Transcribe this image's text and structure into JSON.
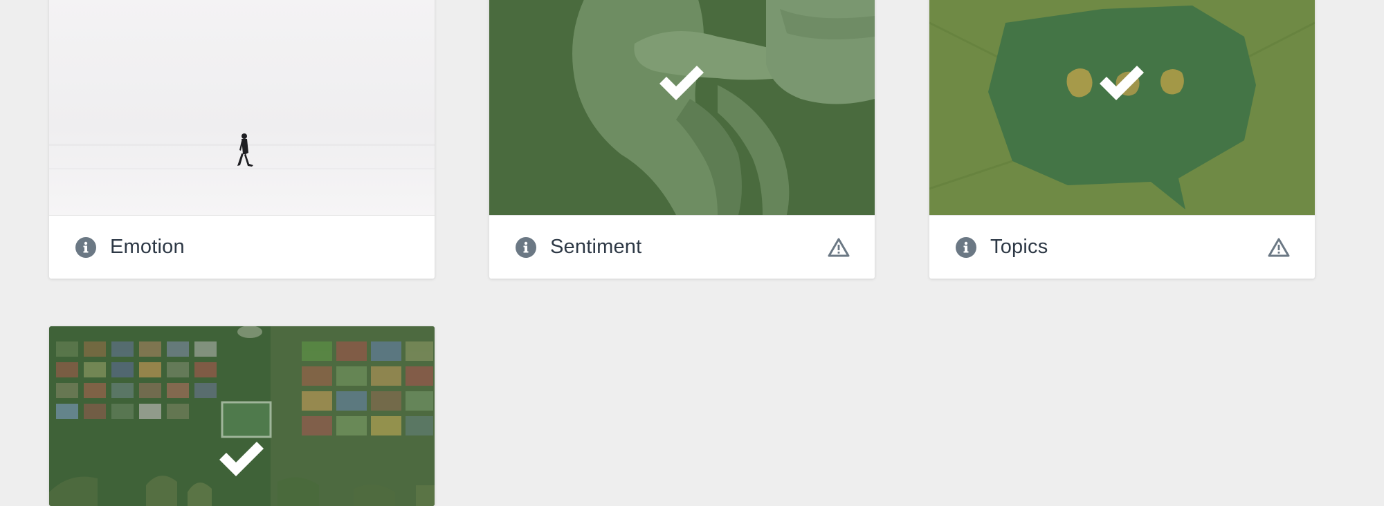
{
  "cards": [
    {
      "title": "Emotion",
      "selected": false,
      "warning": false,
      "icon": "info-icon",
      "image": "person-walking-snow"
    },
    {
      "title": "Sentiment",
      "selected": true,
      "warning": true,
      "icon": "info-icon",
      "image": "holding-hands"
    },
    {
      "title": "Topics",
      "selected": true,
      "warning": true,
      "icon": "info-icon",
      "image": "speech-bubble"
    },
    {
      "title": "",
      "selected": true,
      "warning": false,
      "icon": "info-icon",
      "image": "flags-cafe"
    }
  ],
  "colors": {
    "background": "#eeeeee",
    "card": "#ffffff",
    "title_text": "#2d3845",
    "icon": "#6b7884",
    "overlay_green": "#4a6b3e",
    "overlay_olive": "#6f8a45",
    "check": "#ffffff"
  }
}
